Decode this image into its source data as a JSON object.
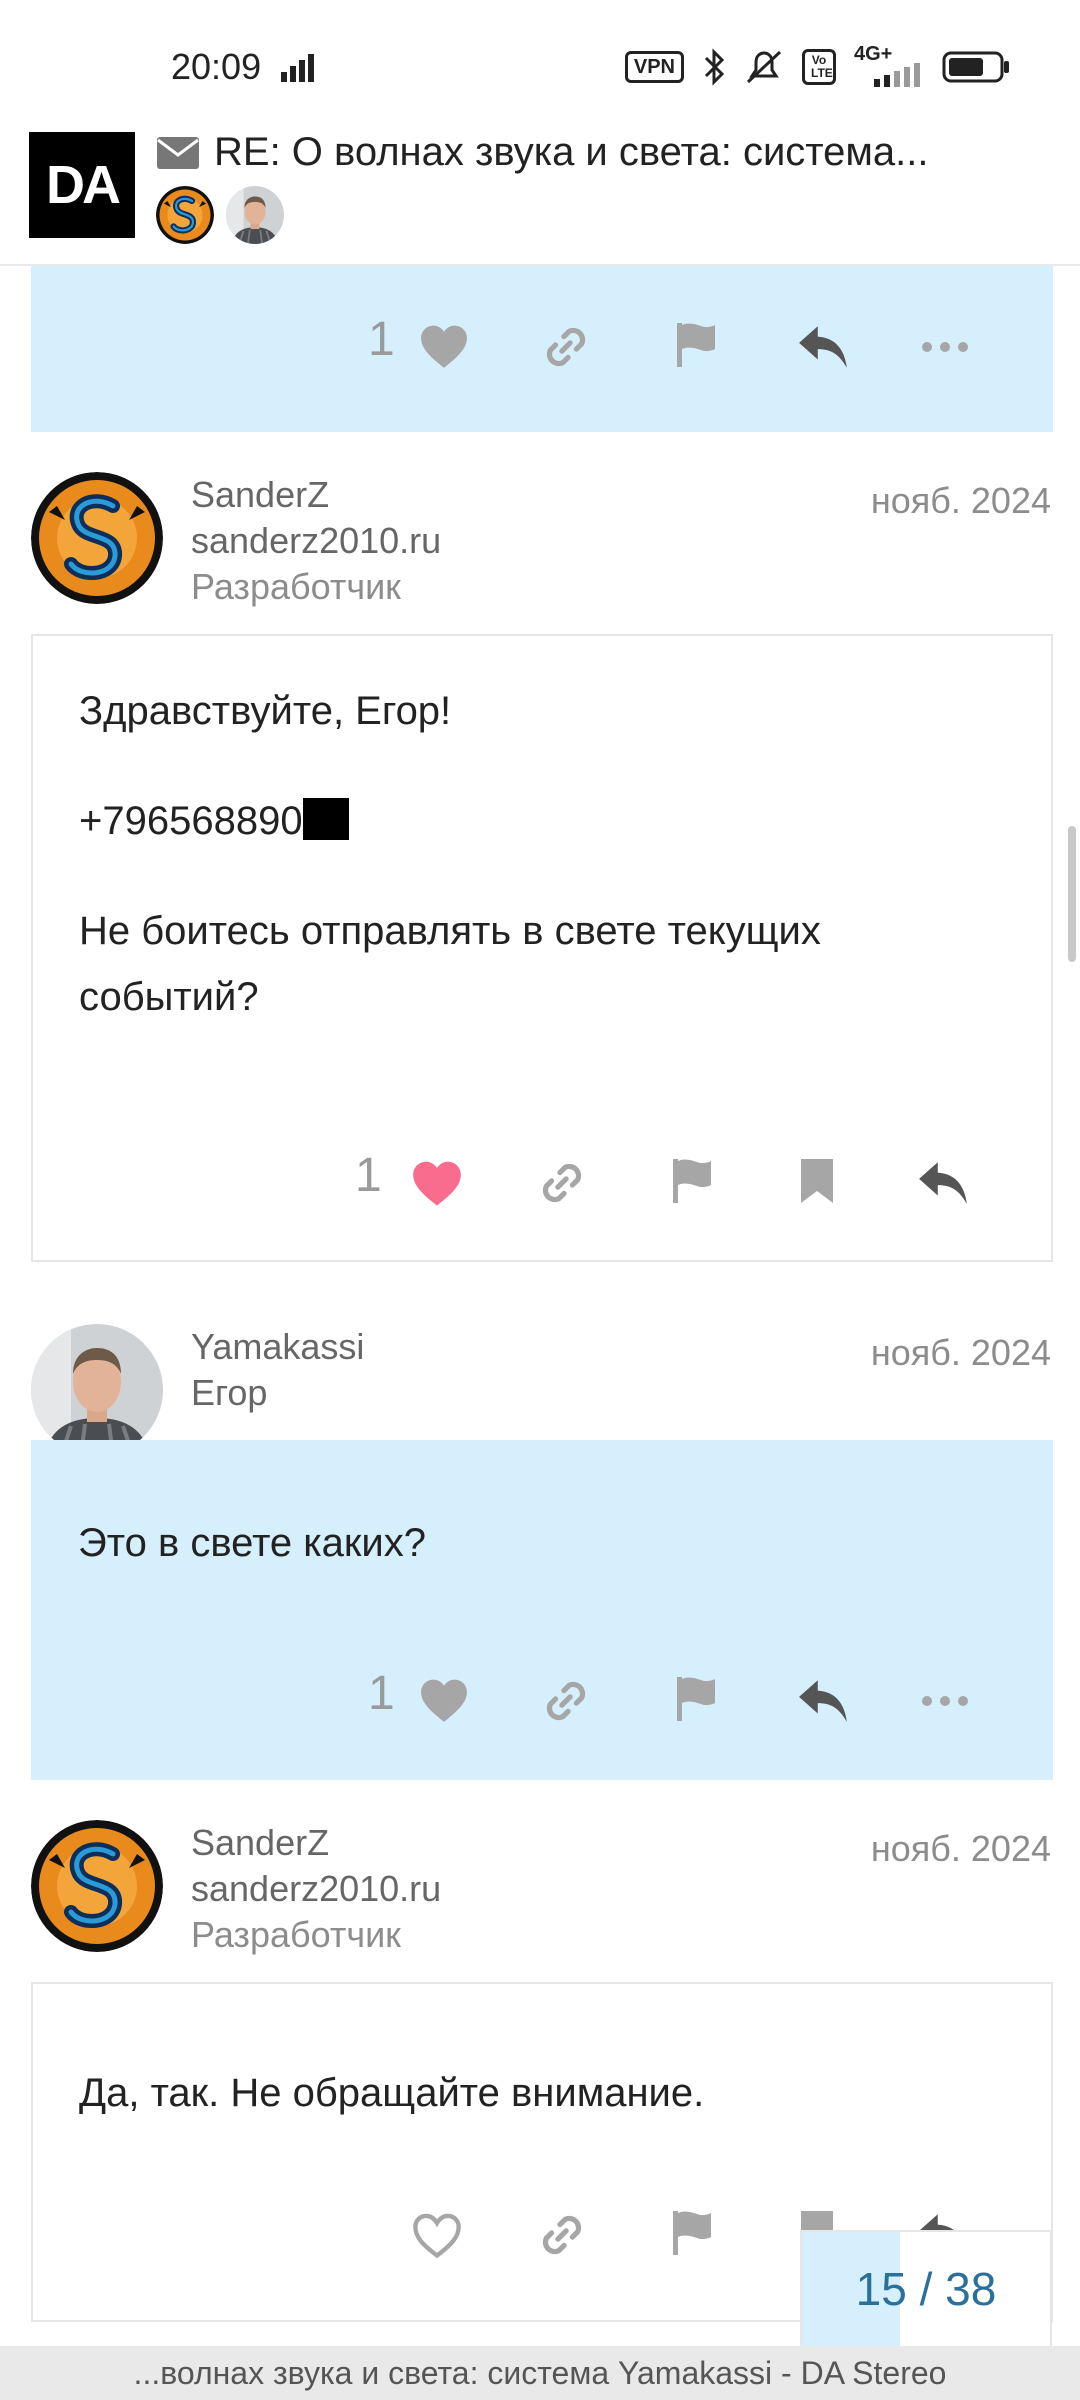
{
  "status_bar": {
    "time": "20:09",
    "vpn": "VPN",
    "volte": "Vo LTE",
    "network": "4G+"
  },
  "header": {
    "logo": "DA",
    "title": "RE: О волнах звука и света: система..."
  },
  "posts": [
    {
      "likes": "1"
    },
    {
      "username": "SanderZ",
      "site": "sanderz2010.ru",
      "role": "Разработчик",
      "date": "нояб. 2024",
      "lines": [
        "Здравствуйте, Егор!",
        "+796568890",
        "Не боитесь отправлять в свете текущих",
        "событий?"
      ],
      "likes": "1"
    },
    {
      "username": "Yamakassi",
      "fullname": "Егор",
      "date": "нояб. 2024",
      "text": "Это в свете каких?",
      "likes": "1"
    },
    {
      "username": "SanderZ",
      "site": "sanderz2010.ru",
      "role": "Разработчик",
      "date": "нояб. 2024",
      "text": "Да, так. Не обращайте внимание."
    }
  ],
  "progress": {
    "label": "15 / 38",
    "current": 15,
    "total": 38
  },
  "bottom_bar": "...волнах звука и света: система Yamakassi - DA Stereo",
  "colors": {
    "highlight": "#d5effd",
    "liked": "#fa6c8d",
    "icon": "#a6a6a6"
  }
}
